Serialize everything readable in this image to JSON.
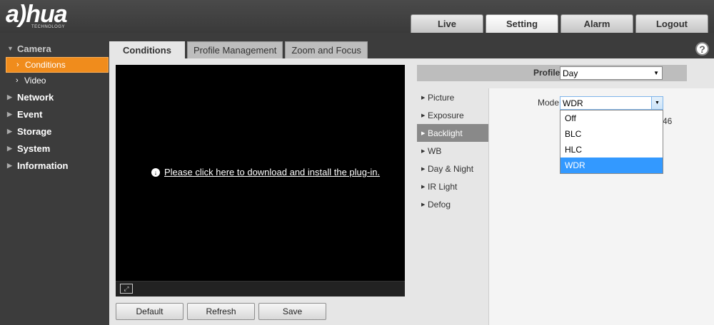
{
  "logo": {
    "main": "a)hua",
    "sub": "TECHNOLOGY"
  },
  "topnav": [
    "Live",
    "Setting",
    "Alarm",
    "Logout"
  ],
  "sidebar": {
    "camera": "Camera",
    "conditions": "Conditions",
    "video": "Video",
    "network": "Network",
    "event": "Event",
    "storage": "Storage",
    "system": "System",
    "information": "Information"
  },
  "subtabs": [
    "Conditions",
    "Profile Management",
    "Zoom and Focus"
  ],
  "help": "?",
  "video": {
    "plugin_text": "Please click here to download and install the plug-in."
  },
  "buttons": {
    "default": "Default",
    "refresh": "Refresh",
    "save": "Save"
  },
  "profile": {
    "label": "Profile",
    "value": "Day"
  },
  "menu": [
    "Picture",
    "Exposure",
    "Backlight",
    "WB",
    "Day & Night",
    "IR Light",
    "Defog"
  ],
  "mode": {
    "label": "Mode",
    "value": "WDR",
    "options": [
      "Off",
      "BLC",
      "HLC",
      "WDR"
    ],
    "partial_value": "46"
  },
  "colors": {
    "accent": "#f08c1c",
    "selected": "#3399ff",
    "menu_active": "#898989"
  }
}
